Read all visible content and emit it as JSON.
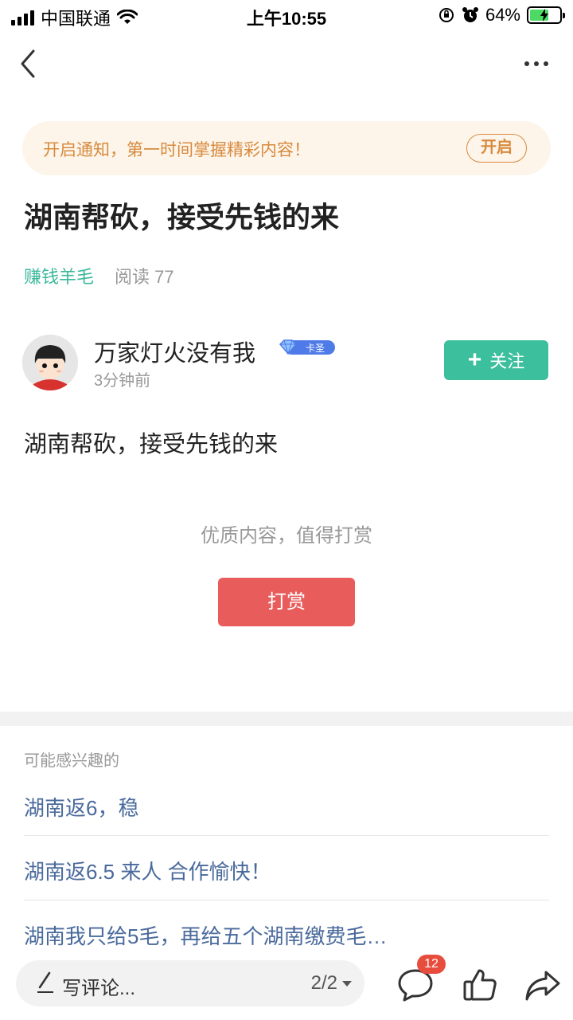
{
  "status_bar": {
    "carrier": "中国联通",
    "time": "上午10:55",
    "battery": "64%",
    "battery_level": 0.64
  },
  "notify": {
    "text": "开启通知，第一时间掌握精彩内容！",
    "button": "开启"
  },
  "post": {
    "title": "湖南帮砍，接受先钱的来",
    "category": "赚钱羊毛",
    "reads": "阅读 77",
    "author": "万家灯火没有我",
    "badge": "卡圣",
    "time": "3分钟前",
    "follow_label": "关注",
    "body": "湖南帮砍，接受先钱的来"
  },
  "reward": {
    "hint": "优质内容，值得打赏",
    "button": "打赏"
  },
  "related": {
    "heading": "可能感兴趣的",
    "items": [
      "湖南返6，稳",
      "湖南返6.5 来人 合作愉快！",
      "湖南我只给5毛，再给五个湖南缴费毛…"
    ]
  },
  "bottom_bar": {
    "comment_placeholder": "写评论...",
    "page_indicator": "2/2",
    "comment_count": "12"
  },
  "icons": [
    "signal-icon",
    "wifi-icon",
    "lock-rotation-icon",
    "alarm-icon",
    "battery-icon",
    "back-icon",
    "more-icon",
    "diamond-badge-icon",
    "plus-icon",
    "pen-icon",
    "comment-icon",
    "like-icon",
    "share-icon"
  ],
  "colors": {
    "accent_green": "#3cbf9d",
    "reward_red": "#e85c5c",
    "notify_orange": "#d88a3e",
    "link_blue": "#4a6a9c"
  }
}
